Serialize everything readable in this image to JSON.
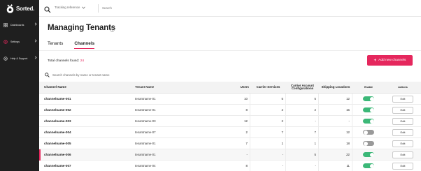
{
  "app": {
    "brand": "Sorted.",
    "accent_color": "#e5275d"
  },
  "sidebar": {
    "items": [
      {
        "label": "Dashboards",
        "icon": "dashboard-icon"
      },
      {
        "label": "Settings",
        "icon": "gear-icon",
        "active": true
      },
      {
        "label": "Help & Support",
        "icon": "help-icon"
      }
    ]
  },
  "topbar": {
    "search_type": "Tracking reference",
    "search_placeholder": "Search"
  },
  "page": {
    "title": "Managing Tenants",
    "tabs": [
      "Tenants",
      "Channels"
    ],
    "active_tab": "Channels",
    "found_label": "Total channels found:",
    "found_count": "24",
    "add_button": "Add new channels",
    "search_placeholder": "Search channels by name or tenant name"
  },
  "table": {
    "headers": {
      "channel": "Channel Name",
      "tenant": "Tenant Name",
      "users": "Users",
      "carrier": "Carrier Services",
      "config": "Carrier Account Configurations",
      "ship": "Shipping Locations",
      "enable": "Enable",
      "actions": "Actions"
    },
    "edit_label": "Edit",
    "rows": [
      {
        "channel": "channelname-001",
        "tenant": "tenantname-01",
        "users": "10",
        "carrier": "5",
        "config": "5",
        "ship": "12",
        "enabled": true
      },
      {
        "channel": "channelname-002",
        "tenant": "tenantname-01",
        "users": "8",
        "carrier": "2",
        "config": "2",
        "ship": "15",
        "enabled": true
      },
      {
        "channel": "channelname-003",
        "tenant": "tenantname-03",
        "users": "12",
        "carrier": "2",
        "config": "-",
        "ship": "-",
        "enabled": true
      },
      {
        "channel": "channelname-004",
        "tenant": "tenantname-07",
        "users": "2",
        "carrier": "7",
        "config": "7",
        "ship": "12",
        "enabled": false
      },
      {
        "channel": "channelname-005",
        "tenant": "tenantname-01",
        "users": "7",
        "carrier": "1",
        "config": "1",
        "ship": "18",
        "enabled": false
      },
      {
        "channel": "channelname-006",
        "tenant": "tenantname-01",
        "users": "-",
        "carrier": "-",
        "config": "5",
        "ship": "22",
        "enabled": true,
        "highlight": true
      },
      {
        "channel": "channelname-007",
        "tenant": "tenantname-04",
        "users": "8",
        "carrier": "-",
        "config": "-",
        "ship": "11",
        "enabled": true
      }
    ]
  }
}
